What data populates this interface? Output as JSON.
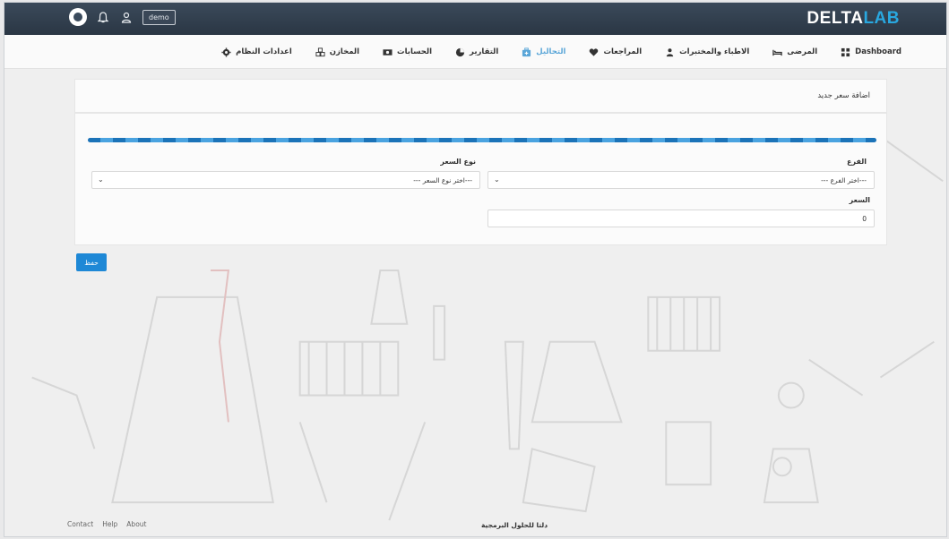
{
  "brand": {
    "part1": "DELTA",
    "part2": "LAB"
  },
  "topbar": {
    "user": "demo"
  },
  "nav": {
    "items": [
      {
        "label": "Dashboard",
        "icon": "dashboard-icon"
      },
      {
        "label": "المرضى",
        "icon": "bed-icon"
      },
      {
        "label": "الاطباء والمختبرات",
        "icon": "doctor-icon"
      },
      {
        "label": "المراجعات",
        "icon": "heart-icon"
      },
      {
        "label": "التحاليل",
        "icon": "kit-icon",
        "active": true
      },
      {
        "label": "التقارير",
        "icon": "pie-icon"
      },
      {
        "label": "الحسابات",
        "icon": "money-icon"
      },
      {
        "label": "المخازن",
        "icon": "cubes-icon"
      },
      {
        "label": "اعدادات النظام",
        "icon": "gear-icon"
      }
    ]
  },
  "card": {
    "title": "اضافة سعر جديد"
  },
  "form": {
    "branch_label": "الفرع",
    "branch_value": "--- اختر الفرع---",
    "price_type_label": "نوع السعر",
    "price_type_value": "--- اختر نوع السعر---",
    "price_label": "السعر",
    "price_value": "0",
    "save_label": "حفظ"
  },
  "footer": {
    "links": [
      "Contact",
      "Help",
      "About"
    ],
    "center": "دلتا للحلول البرمجية"
  },
  "colors": {
    "accent": "#1e88d6",
    "topbar": "#2f3b4a",
    "brand_accent": "#29a8e0"
  }
}
